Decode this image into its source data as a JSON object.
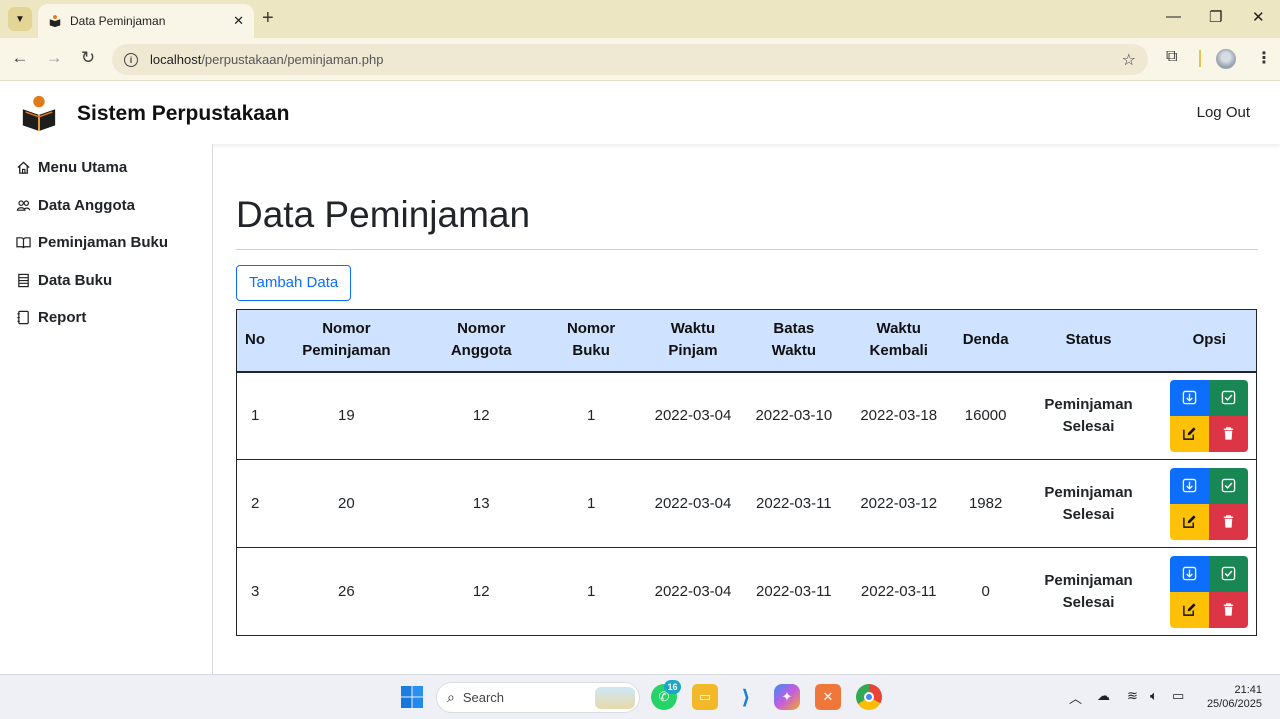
{
  "browser": {
    "tab_title": "Data Peminjaman",
    "url_host": "localhost",
    "url_path": "/perpustakaan/peminjaman.php"
  },
  "header": {
    "brand": "Sistem Perpustakaan",
    "logout": "Log Out"
  },
  "sidebar": {
    "items": [
      {
        "label": "Menu Utama",
        "icon": "home-icon"
      },
      {
        "label": "Data Anggota",
        "icon": "users-icon"
      },
      {
        "label": "Peminjaman Buku",
        "icon": "book-open-icon"
      },
      {
        "label": "Data Buku",
        "icon": "list-icon"
      },
      {
        "label": "Report",
        "icon": "journal-icon"
      }
    ]
  },
  "main": {
    "title": "Data Peminjaman",
    "add_button": "Tambah Data",
    "table": {
      "headers": {
        "no": "No",
        "nomor_peminjaman_1": "Nomor",
        "nomor_peminjaman_2": "Peminjaman",
        "nomor_anggota_1": "Nomor",
        "nomor_anggota_2": "Anggota",
        "nomor_buku_1": "Nomor",
        "nomor_buku_2": "Buku",
        "waktu_pinjam_1": "Waktu",
        "waktu_pinjam_2": "Pinjam",
        "batas_waktu_1": "Batas",
        "batas_waktu_2": "Waktu",
        "waktu_kembali_1": "Waktu",
        "waktu_kembali_2": "Kembali",
        "denda": "Denda",
        "status": "Status",
        "opsi": "Opsi"
      },
      "rows": [
        {
          "no": "1",
          "nomor_peminjaman": "19",
          "nomor_anggota": "12",
          "nomor_buku": "1",
          "waktu_pinjam": "2022-03-04",
          "batas_waktu": "2022-03-10",
          "waktu_kembali": "2022-03-18",
          "denda": "16000",
          "status_1": "Peminjaman",
          "status_2": "Selesai"
        },
        {
          "no": "2",
          "nomor_peminjaman": "20",
          "nomor_anggota": "13",
          "nomor_buku": "1",
          "waktu_pinjam": "2022-03-04",
          "batas_waktu": "2022-03-11",
          "waktu_kembali": "2022-03-12",
          "denda": "1982",
          "status_1": "Peminjaman",
          "status_2": "Selesai"
        },
        {
          "no": "3",
          "nomor_peminjaman": "26",
          "nomor_anggota": "12",
          "nomor_buku": "1",
          "waktu_pinjam": "2022-03-04",
          "batas_waktu": "2022-03-11",
          "waktu_kembali": "2022-03-11",
          "denda": "0",
          "status_1": "Peminjaman",
          "status_2": "Selesai"
        }
      ]
    }
  },
  "taskbar": {
    "search_placeholder": "Search",
    "whatsapp_badge": "16",
    "time": "21:41",
    "date": "25/06/2025"
  },
  "colors": {
    "primary": "#0d6efd",
    "success": "#198754",
    "warning": "#ffc107",
    "danger": "#dc3545",
    "table_header": "#cfe2ff"
  }
}
